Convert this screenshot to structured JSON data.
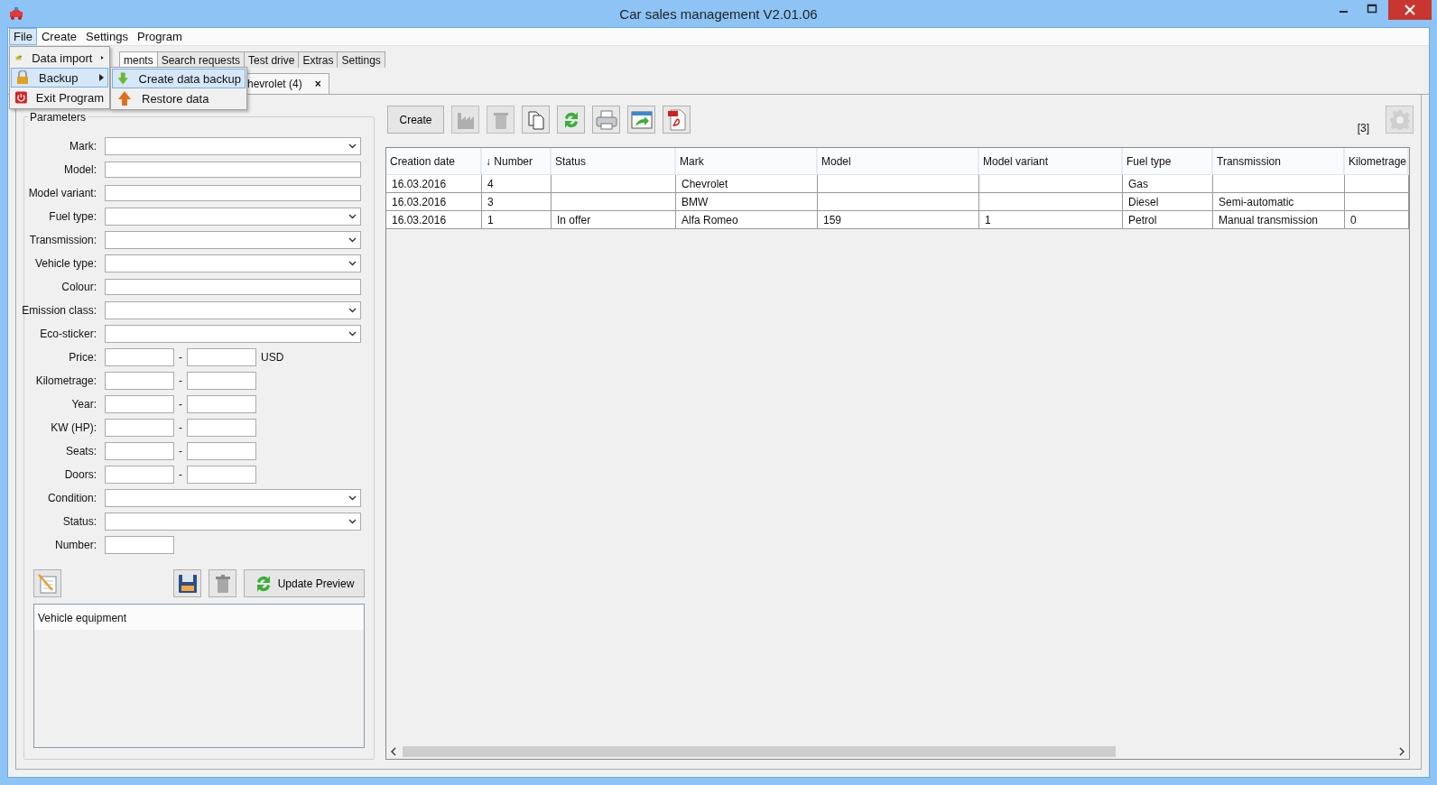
{
  "window": {
    "title": "Car sales management V2.01.06"
  },
  "menu_bar": [
    {
      "label": "File",
      "selected": true
    },
    {
      "label": "Create",
      "selected": false
    },
    {
      "label": "Settings",
      "selected": false
    },
    {
      "label": "Program",
      "selected": false
    }
  ],
  "file_menu": [
    {
      "label": "Data import",
      "has_submenu": true,
      "selected": false
    },
    {
      "label": "Backup",
      "has_submenu": true,
      "selected": true
    },
    {
      "label": "Exit Program",
      "has_submenu": false,
      "selected": false
    }
  ],
  "backup_submenu": [
    {
      "label": "Create data backup",
      "selected": true
    },
    {
      "label": "Restore data",
      "selected": false
    }
  ],
  "tabs": [
    {
      "label": "ments",
      "selected": true
    },
    {
      "label": "Search requests",
      "selected": false
    },
    {
      "label": "Test drive",
      "selected": false
    },
    {
      "label": "Extras",
      "selected": false
    },
    {
      "label": "Settings",
      "selected": false
    }
  ],
  "document_tabs": [
    {
      "label": "hevrolet (4)",
      "close": "×"
    }
  ],
  "parameters": {
    "title": "Parameters",
    "fields": [
      {
        "label": "Mark:",
        "kind": "dropdown"
      },
      {
        "label": "Model:",
        "kind": "text"
      },
      {
        "label": "Model variant:",
        "kind": "text"
      },
      {
        "label": "Fuel type:",
        "kind": "dropdown"
      },
      {
        "label": "Transmission:",
        "kind": "dropdown"
      },
      {
        "label": "Vehicle type:",
        "kind": "dropdown"
      },
      {
        "label": "Colour:",
        "kind": "text"
      },
      {
        "label": "Emission class:",
        "kind": "dropdown"
      },
      {
        "label": "Eco-sticker:",
        "kind": "dropdown"
      },
      {
        "label": "Price:",
        "kind": "range",
        "separator": "-",
        "unit": "USD"
      },
      {
        "label": "Kilometrage:",
        "kind": "range",
        "separator": "-"
      },
      {
        "label": "Year:",
        "kind": "range",
        "separator": "-"
      },
      {
        "label": "KW (HP):",
        "kind": "range",
        "separator": "-"
      },
      {
        "label": "Seats:",
        "kind": "range",
        "separator": "-"
      },
      {
        "label": "Doors:",
        "kind": "range",
        "separator": "-"
      },
      {
        "label": "Condition:",
        "kind": "dropdown"
      },
      {
        "label": "Status:",
        "kind": "dropdown"
      },
      {
        "label": "Number:",
        "kind": "short"
      }
    ],
    "update_button": "Update Preview",
    "equipment_title": "Vehicle equipment"
  },
  "toolbar": {
    "create": "Create",
    "tools": [
      {
        "disabled": true
      },
      {
        "disabled": true
      },
      {
        "disabled": false
      },
      {
        "disabled": false
      },
      {
        "disabled": false
      },
      {
        "disabled": false
      },
      {
        "disabled": false
      }
    ],
    "count": "[3]",
    "settings_disabled": true
  },
  "table": {
    "columns": [
      "Creation date",
      "↓ Number",
      "Status",
      "Mark",
      "Model",
      "Model variant",
      "Fuel type",
      "Transmission",
      "Kilometrage"
    ],
    "rows": [
      [
        "16.03.2016",
        "4",
        "",
        "Chevrolet",
        "",
        "",
        "Gas",
        "",
        ""
      ],
      [
        "16.03.2016",
        "3",
        "",
        "BMW",
        "",
        "",
        "Diesel",
        "Semi-automatic",
        ""
      ],
      [
        "16.03.2016",
        "1",
        "In offer",
        "Alfa Romeo",
        "159",
        "1",
        "Petrol",
        "Manual transmission",
        "0"
      ]
    ]
  }
}
